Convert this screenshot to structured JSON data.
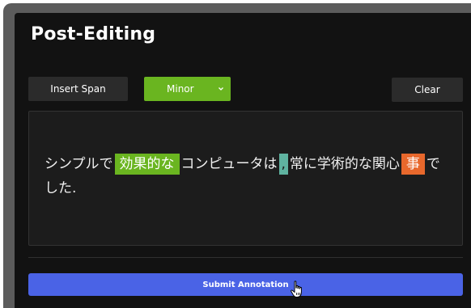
{
  "header": {
    "title": "Post-Editing"
  },
  "toolbar": {
    "insert_span_label": "Insert Span",
    "severity_selected": "Minor",
    "clear_label": "Clear"
  },
  "editor": {
    "segments": [
      {
        "text": "シンプルで",
        "highlight": null
      },
      {
        "text": "効果的な",
        "highlight": "green"
      },
      {
        "text": "コンピュータは",
        "highlight": null
      },
      {
        "text": ",",
        "highlight": "teal"
      },
      {
        "text": "常に学術的な関心",
        "highlight": null
      },
      {
        "text": "事",
        "highlight": "orange"
      },
      {
        "text": "でした.",
        "highlight": null
      }
    ]
  },
  "footer": {
    "submit_label": "Submit Annotation"
  },
  "colors": {
    "background": "#121212",
    "minor_green": "#6ab520",
    "teal": "#5fb3a0",
    "orange": "#e8682c",
    "submit_blue": "#4a63e6"
  },
  "icons": {
    "dropdown": "chevron-down-icon",
    "cursor": "hand-pointer-icon"
  }
}
